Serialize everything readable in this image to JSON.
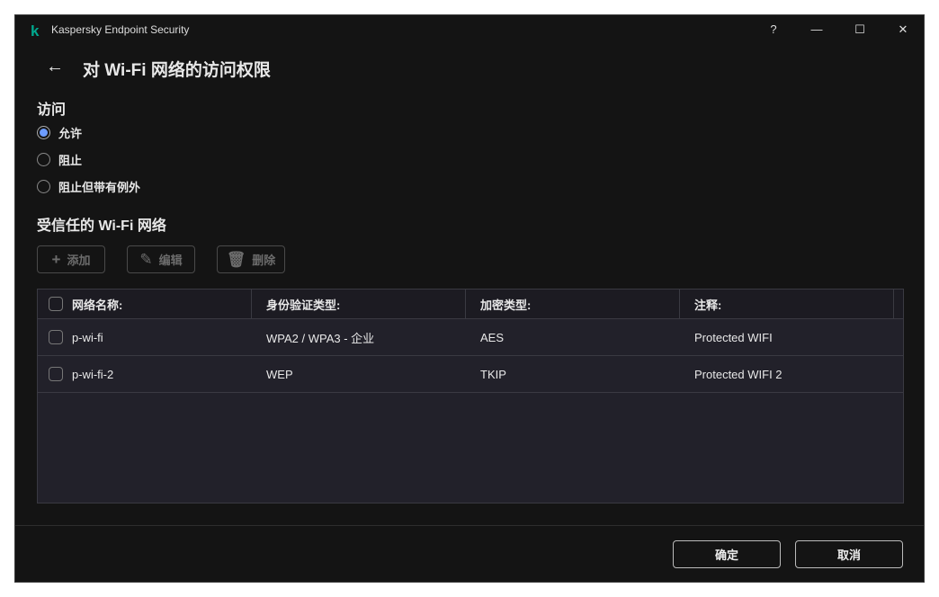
{
  "app": {
    "title": "Kaspersky Endpoint Security",
    "help": "?",
    "minimize": "—",
    "maximize": "☐",
    "close": "✕"
  },
  "page": {
    "back": "←",
    "title": "对 Wi-Fi 网络的访问权限"
  },
  "access": {
    "heading": "访问",
    "options": [
      {
        "label": "允许",
        "selected": true
      },
      {
        "label": "阻止",
        "selected": false
      },
      {
        "label": "阻止但带有例外",
        "selected": false
      }
    ]
  },
  "trusted": {
    "heading": "受信任的 Wi-Fi 网络",
    "add": "添加",
    "edit": "编辑",
    "delete": "删除"
  },
  "table": {
    "headers": [
      "网络名称:",
      "身份验证类型:",
      "加密类型:",
      "注释:"
    ],
    "rows": [
      [
        "p-wi-fi",
        "WPA2 / WPA3 - 企业",
        "AES",
        "Protected WIFI"
      ],
      [
        "p-wi-fi-2",
        "WEP",
        "TKIP",
        "Protected WIFI 2"
      ]
    ]
  },
  "footer": {
    "ok": "确定",
    "cancel": "取消"
  }
}
